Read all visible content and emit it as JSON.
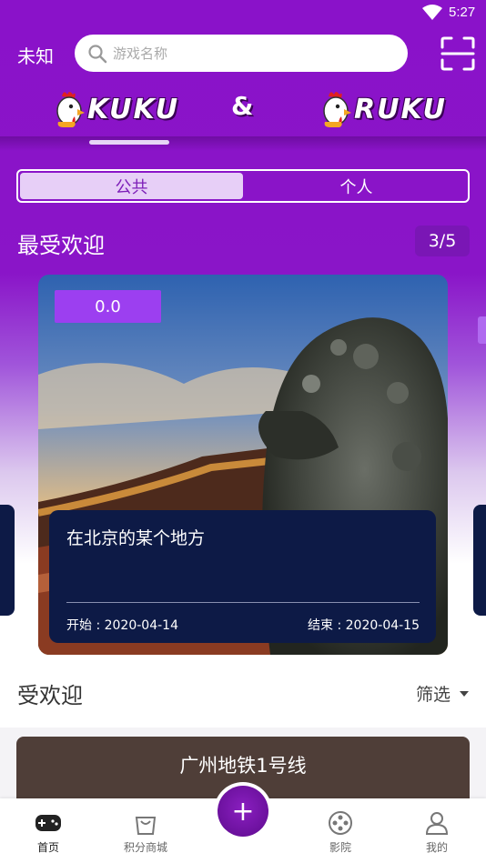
{
  "status_bar": {
    "time": "5:27"
  },
  "header": {
    "location": "未知",
    "search_placeholder": "游戏名称",
    "logo_left": "KUKU",
    "ampersand": "&",
    "logo_right": "RUKU"
  },
  "segment": {
    "tabs": [
      "公共",
      "个人"
    ],
    "active": 0
  },
  "featured": {
    "title": "最受欢迎",
    "pager": "3/5",
    "card": {
      "score": "0.0",
      "name": "在北京的某个地方",
      "start": "开始 : 2020-04-14",
      "end": "结束 : 2020-04-15"
    }
  },
  "popular": {
    "title": "受欢迎",
    "filter_label": "筛选",
    "items": [
      {
        "name": "广州地铁1号线"
      }
    ]
  },
  "tabbar": {
    "items": [
      {
        "label": "首页",
        "icon": "gamepad-icon",
        "active": true
      },
      {
        "label": "积分商城",
        "icon": "shopping-bag-icon"
      },
      {
        "label": "影院",
        "icon": "film-reel-icon"
      },
      {
        "label": "我的",
        "icon": "user-icon"
      }
    ],
    "fab_icon": "plus-icon"
  },
  "colors": {
    "brand_purple": "#8a12c9",
    "card_navy": "#0d1a46",
    "score_purple": "#9c3ff0"
  }
}
